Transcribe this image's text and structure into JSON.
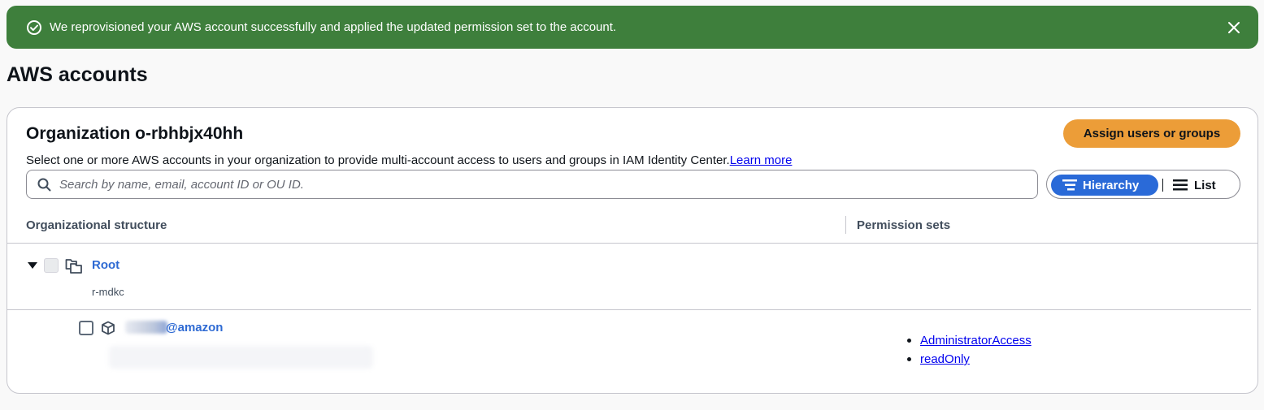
{
  "flash": {
    "type": "success",
    "message": "We reprovisioned your AWS account successfully and applied the updated permission set to the account.",
    "icons": {
      "status": "check-circle-icon",
      "dismiss": "close-icon"
    }
  },
  "page": {
    "title": "AWS accounts"
  },
  "organization": {
    "title": "Organization o-rbhbjx40hh",
    "assign_button_label": "Assign users or groups",
    "description": "Select one or more AWS accounts in your organization to provide multi-account access to users and groups in IAM Identity Center.",
    "learn_more_label": "Learn more"
  },
  "search": {
    "placeholder": "Search by name, email, account ID or OU ID.",
    "value": ""
  },
  "view_toggle": {
    "selected": "Hierarchy",
    "options": [
      {
        "label": "Hierarchy",
        "icon": "hierarchy-icon"
      },
      {
        "label": "List",
        "icon": "list-icon"
      }
    ]
  },
  "table": {
    "columns": [
      "Organizational structure",
      "Permission sets"
    ],
    "root": {
      "name": "Root",
      "id": "r-mdkc",
      "expanded": true
    },
    "accounts": [
      {
        "name_visible": "@amazon",
        "permission_sets": [
          "AdministratorAccess",
          "readOnly"
        ]
      }
    ]
  },
  "colors": {
    "success": "#3e7f3c",
    "primary_button": "#ec9d38",
    "selected_toggle": "#2a6ad8",
    "link": "#2e6ad3"
  }
}
